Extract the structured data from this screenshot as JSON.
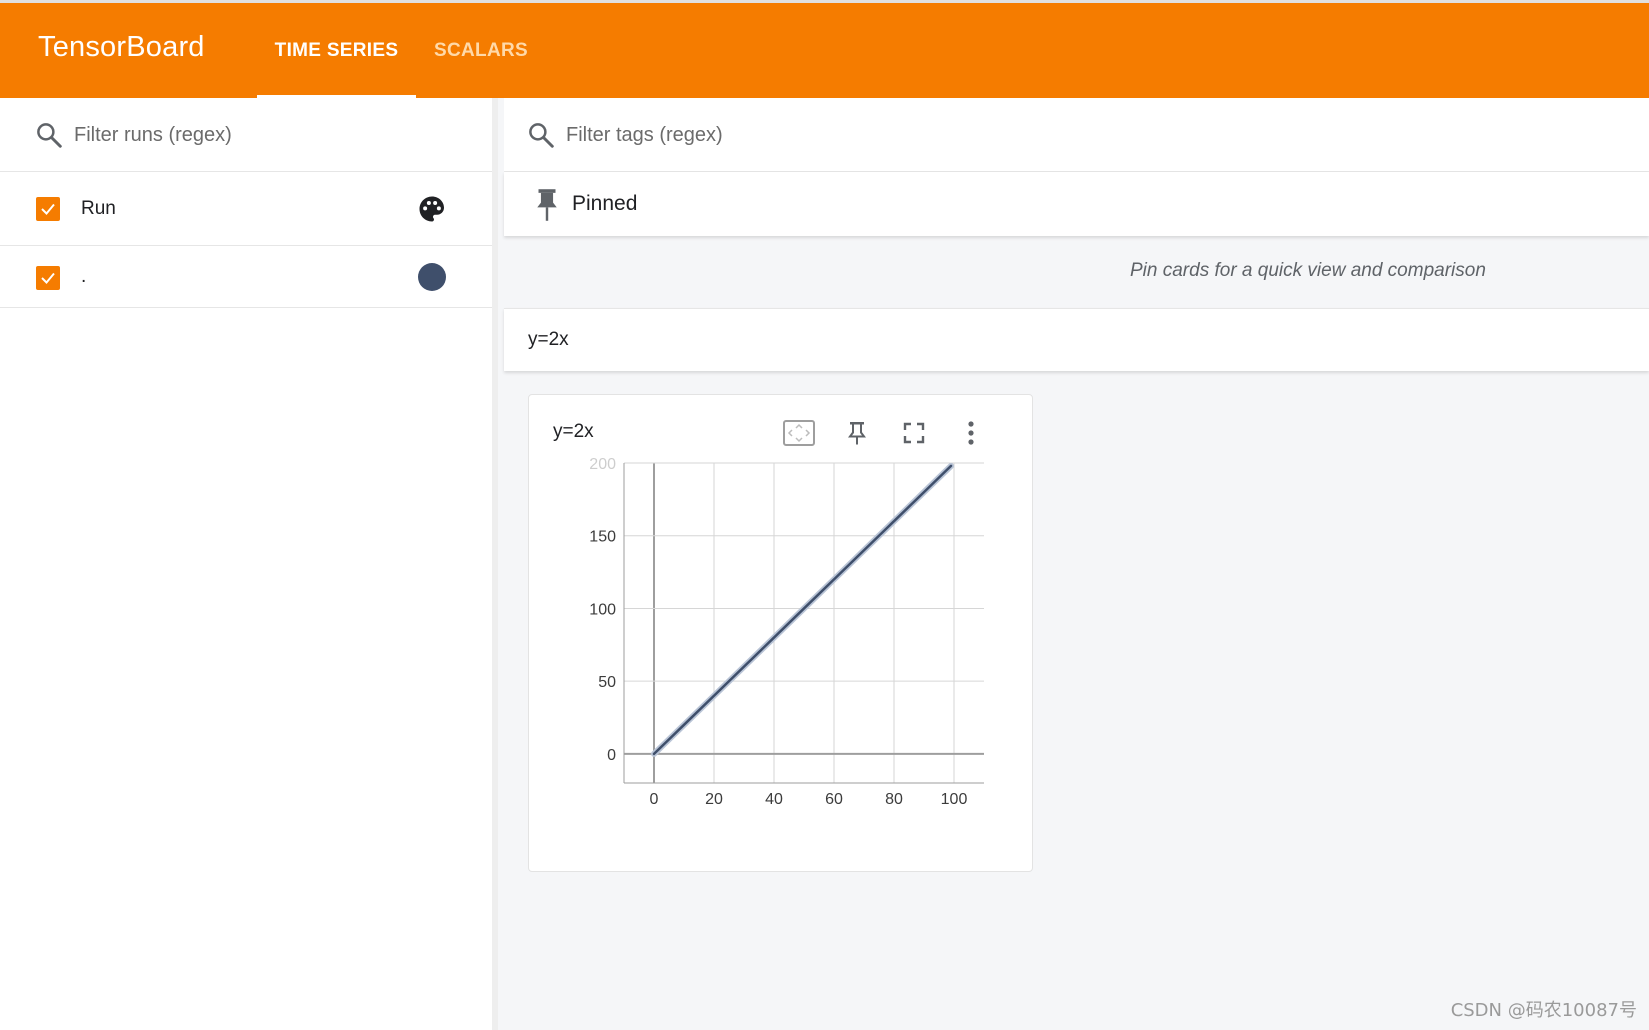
{
  "header": {
    "brand": "TensorBoard",
    "tabs": [
      {
        "label": "TIME SERIES",
        "active": true
      },
      {
        "label": "SCALARS",
        "active": false
      }
    ],
    "accent_color": "#f57c00"
  },
  "sidebar": {
    "filter_runs_placeholder": "Filter runs (regex)",
    "filter_runs_value": "",
    "runs_header": {
      "label": "Run",
      "checked": true,
      "icon": "palette-icon"
    },
    "runs": [
      {
        "label": ".",
        "checked": true,
        "color": "#3f4f6b"
      }
    ]
  },
  "main": {
    "filter_tags_placeholder": "Filter tags (regex)",
    "filter_tags_value": "",
    "pinned": {
      "title": "Pinned",
      "empty_message": "Pin cards for a quick view and comparison"
    },
    "group": {
      "title": "y=2x"
    },
    "card": {
      "title": "y=2x",
      "actions": [
        "fit-domain-icon",
        "pin-icon",
        "fullscreen-icon",
        "more-vert-icon"
      ]
    }
  },
  "chart_data": {
    "type": "line",
    "title": "y=2x",
    "xlabel": "",
    "ylabel": "",
    "xlim": [
      -10,
      110
    ],
    "ylim": [
      -20,
      200
    ],
    "x_ticks": [
      0,
      20,
      40,
      60,
      80,
      100
    ],
    "y_ticks": [
      0,
      50,
      100,
      150,
      200
    ],
    "grid": true,
    "series": [
      {
        "color": "#3f4f6b",
        "x": [
          0,
          5,
          10,
          20,
          30,
          40,
          50,
          60,
          70,
          80,
          90,
          99
        ],
        "y": [
          0,
          10,
          20,
          40,
          60,
          80,
          100,
          120,
          140,
          160,
          180,
          198
        ]
      }
    ]
  },
  "watermark": "CSDN @码农10087号"
}
